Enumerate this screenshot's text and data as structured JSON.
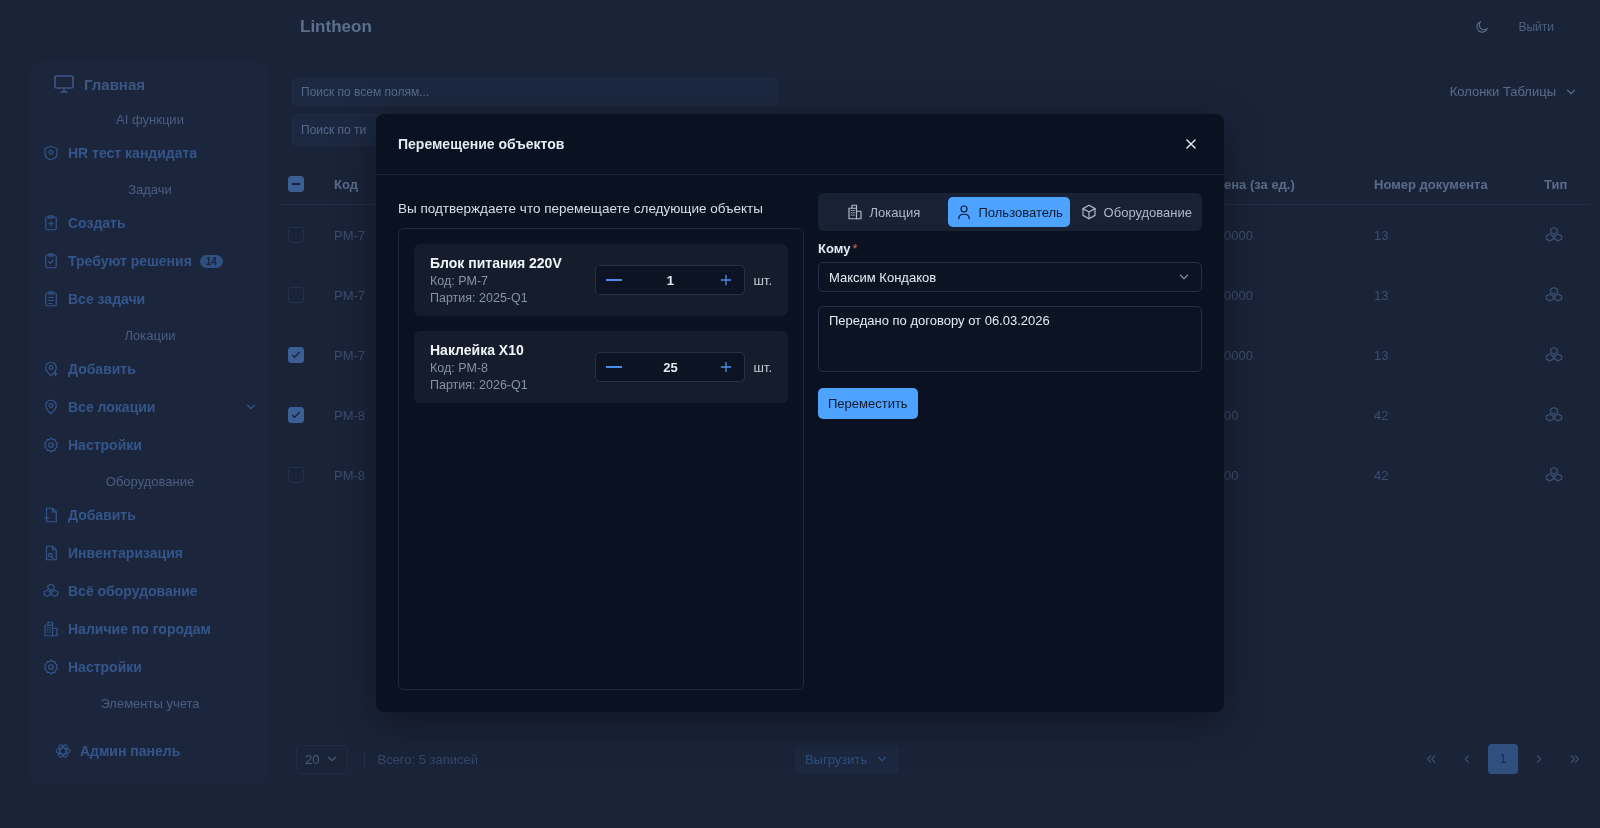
{
  "header": {
    "title": "Lintheon",
    "logout": "Выйти"
  },
  "sidebar": {
    "home": "Главная",
    "sections": [
      {
        "title": "AI функции",
        "items": [
          {
            "label": "HR тест кандидата"
          }
        ]
      },
      {
        "title": "Задачи",
        "items": [
          {
            "label": "Создать"
          },
          {
            "label": "Требуют решения",
            "badge": "14"
          },
          {
            "label": "Все задачи"
          }
        ]
      },
      {
        "title": "Локации",
        "items": [
          {
            "label": "Добавить"
          },
          {
            "label": "Все локации",
            "expanded": false
          },
          {
            "label": "Настройки"
          }
        ]
      },
      {
        "title": "Оборудование",
        "items": [
          {
            "label": "Добавить"
          },
          {
            "label": "Инвентаризация"
          },
          {
            "label": "Всё оборудование"
          },
          {
            "label": "Наличие по городам"
          },
          {
            "label": "Настройки"
          }
        ]
      },
      {
        "title": "Элементы учета"
      }
    ],
    "admin": "Админ панель"
  },
  "filters": {
    "search_placeholder": "Поиск по всем полям...",
    "type_placeholder": "Поиск по ти",
    "columns_button": "Колонки Таблицы"
  },
  "table": {
    "select_all_indeterminate": true,
    "columns": [
      {
        "label": "Код"
      },
      {
        "label": "ена (за ед.)"
      },
      {
        "label": "Номер документа"
      },
      {
        "label": "Тип"
      }
    ],
    "rows": [
      {
        "selected": false,
        "code": "PM-7",
        "price": "0000",
        "document": "13"
      },
      {
        "selected": false,
        "code": "PM-7",
        "price": "0000",
        "document": "13"
      },
      {
        "selected": true,
        "code": "PM-7",
        "price": "0000",
        "document": "13"
      },
      {
        "selected": true,
        "code": "PM-8",
        "price": "00",
        "document": "42"
      },
      {
        "selected": false,
        "code": "PM-8",
        "price": "00",
        "document": "42"
      }
    ]
  },
  "footer": {
    "page_size": "20",
    "total": "Всего: 5 записей",
    "export": "Выгрузить",
    "pages": [
      {
        "label": "1",
        "selected": true
      }
    ]
  },
  "modal": {
    "title": "Перемещение объектов",
    "prompt": "Вы подтверждаете что перемещаете следующие объекты",
    "items": [
      {
        "name": "Блок питания 220V",
        "code": "Код: PM-7",
        "batch": "Партия: 2025-Q1",
        "quantity": "1",
        "unit": "шт."
      },
      {
        "name": "Наклейка X10",
        "code": "Код: PM-8",
        "batch": "Партия: 2026-Q1",
        "quantity": "25",
        "unit": "шт."
      }
    ],
    "tabs": [
      {
        "label": "Локация",
        "selected": false
      },
      {
        "label": "Пользователь",
        "selected": true
      },
      {
        "label": "Оборудование",
        "selected": false
      }
    ],
    "recipient_label": "Кому",
    "required_mark": "*",
    "recipient": "Максим Кондаков",
    "comment": "Передано по договору от 06.03.2026",
    "submit": "Переместить"
  }
}
